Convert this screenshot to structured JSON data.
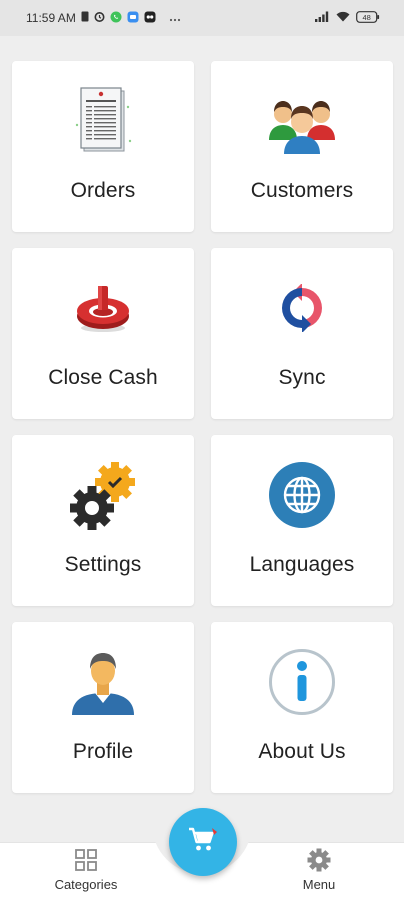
{
  "status_bar": {
    "time": "11:59 AM",
    "icons": [
      "sim-icon",
      "alarm-icon",
      "whatsapp-icon",
      "messages-icon",
      "camera-app-icon",
      "more-dots-icon"
    ],
    "battery": "48"
  },
  "tiles": [
    {
      "label": "Orders",
      "icon": "orders-document-icon"
    },
    {
      "label": "Customers",
      "icon": "customers-group-icon"
    },
    {
      "label": "Close Cash",
      "icon": "power-button-icon"
    },
    {
      "label": "Sync",
      "icon": "sync-icon"
    },
    {
      "label": "Settings",
      "icon": "settings-gears-icon"
    },
    {
      "label": "Languages",
      "icon": "globe-icon"
    },
    {
      "label": "Profile",
      "icon": "profile-user-icon"
    },
    {
      "label": "About Us",
      "icon": "info-icon"
    }
  ],
  "bottom_nav": {
    "categories_label": "Categories",
    "menu_label": "Menu",
    "cart_icon": "cart-icon"
  },
  "colors": {
    "background": "#eeeeee",
    "fab": "#33b4e6",
    "globe": "#2d7fb7",
    "sync_blue": "#1f4fa0",
    "sync_red": "#e8556a"
  }
}
